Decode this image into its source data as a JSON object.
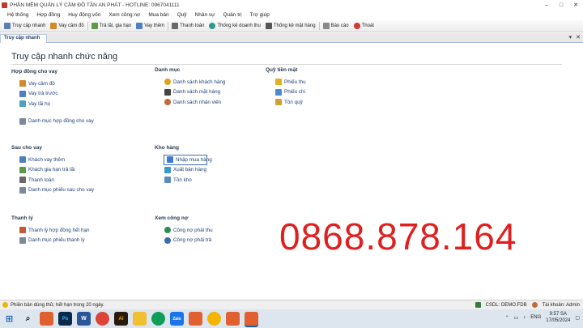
{
  "window": {
    "title": "PHẦN MỀM QUẢN LÝ CẦM ĐỒ TÂN AN PHÁT - HOTLINE: 0967041111"
  },
  "menu": [
    "Hệ thống",
    "Hợp đồng",
    "Huy động vốn",
    "Xem công nợ",
    "Mua bán",
    "Quỹ",
    "Nhân sự",
    "Quản trị",
    "Trợ giúp"
  ],
  "toolbar": [
    {
      "label": "Truy cập nhanh",
      "icon": "grid-icon",
      "color": "#5b7fb5"
    },
    {
      "label": "Vay cầm đồ",
      "icon": "pawn-icon",
      "color": "#d08a2c"
    },
    {
      "label": "Trả lãi, gia hạn",
      "icon": "receipt-icon",
      "color": "#5a9a4a"
    },
    {
      "label": "Vay thêm",
      "icon": "add-loan-icon",
      "color": "#4f7fc0"
    },
    {
      "label": "Thanh toán",
      "icon": "payment-icon",
      "color": "#6a6a6a"
    },
    {
      "label": "Thống kê doanh thu",
      "icon": "revenue-icon",
      "color": "#2f9a8a"
    },
    {
      "label": "Thống kê mặt hàng",
      "icon": "car-icon",
      "color": "#555555"
    },
    {
      "label": "Báo cáo",
      "icon": "report-icon",
      "color": "#8a8a8a"
    },
    {
      "label": "Thoát",
      "icon": "exit-icon",
      "color": "#d43a2f"
    }
  ],
  "tab": {
    "label": "Truy cập nhanh"
  },
  "panel": {
    "heading": "Truy cập nhanh chức năng"
  },
  "groups": {
    "hop_dong": {
      "title": "Hợp đồng cho vay",
      "links": [
        "Vay cầm đồ",
        "Vay trả trước",
        "Vay lãi họ",
        "Danh mục hợp đồng cho vay"
      ]
    },
    "sau_cho_vay": {
      "title": "Sau cho vay",
      "links": [
        "Khách vay thêm",
        "Khách gia hạn trả lãi",
        "Thanh toán",
        "Danh mục phiếu sau cho vay"
      ]
    },
    "thanh_ly": {
      "title": "Thanh lý",
      "links": [
        "Thanh lý hợp đồng hết hạn",
        "Danh mục phiếu thanh lý"
      ]
    },
    "danh_muc": {
      "title": "Danh mục",
      "links": [
        "Danh sách khách hàng",
        "Danh sách mặt hàng",
        "Danh sách nhân viên"
      ]
    },
    "kho_hang": {
      "title": "Kho hàng",
      "links": [
        "Nhập mua hàng",
        "Xuất bán hàng",
        "Tồn kho"
      ]
    },
    "xem_cong_no": {
      "title": "Xem công nợ",
      "links": [
        "Công nợ phải thu",
        "Công nợ phải trả"
      ]
    },
    "quy_tien_mat": {
      "title": "Quỹ tiền mặt",
      "links": [
        "Phiếu thu",
        "Phiếu chi",
        "Tồn quỹ"
      ]
    }
  },
  "hotline_overlay": "0868.878.164",
  "status": {
    "message": "Phiên bản dùng thử, hết hạn trong 20 ngày.",
    "db": "CSDL: DEMO.FDB",
    "account": "Tài khoản: Admin"
  },
  "tray": {
    "lang": "ENG",
    "time": "9:57 SA",
    "date": "17/05/2024"
  }
}
